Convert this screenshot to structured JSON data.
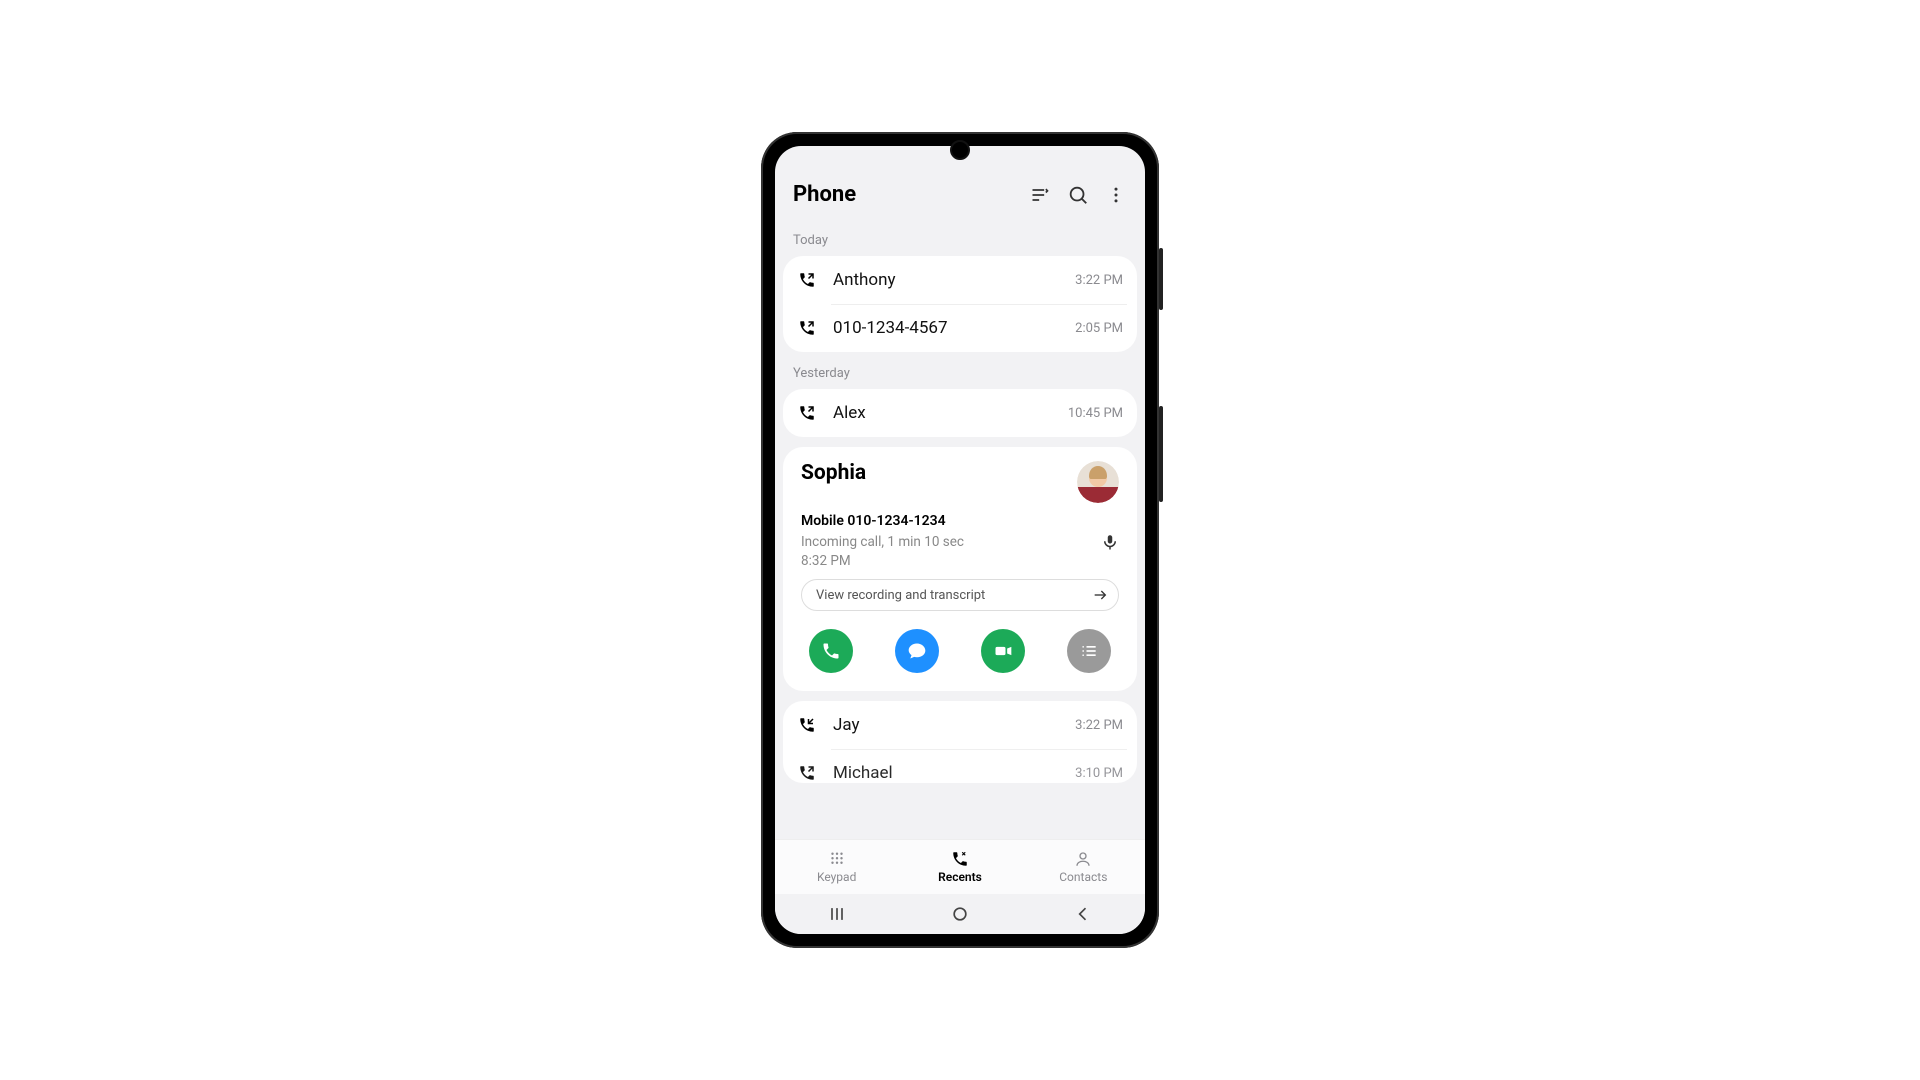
{
  "header": {
    "title": "Phone"
  },
  "groups": [
    {
      "label": "Today",
      "items": [
        {
          "icon": "outgoing",
          "name": "Anthony",
          "time": "3:22 PM"
        },
        {
          "icon": "outgoing",
          "name": "010-1234-4567",
          "time": "2:05 PM"
        }
      ]
    },
    {
      "label": "Yesterday",
      "items": [
        {
          "icon": "outgoing",
          "name": "Alex",
          "time": "10:45 PM"
        }
      ]
    }
  ],
  "expanded": {
    "name": "Sophia",
    "line": "Mobile 010-1234-1234",
    "detail": "Incoming call, 1 min 10 sec",
    "time": "8:32 PM",
    "chip": "View recording and transcript"
  },
  "after": [
    {
      "icon": "incoming",
      "name": "Jay",
      "time": "3:22 PM"
    },
    {
      "icon": "outgoing",
      "name": "Michael",
      "time": "3:10 PM"
    }
  ],
  "tabs": {
    "keypad": "Keypad",
    "recents": "Recents",
    "contacts": "Contacts"
  }
}
